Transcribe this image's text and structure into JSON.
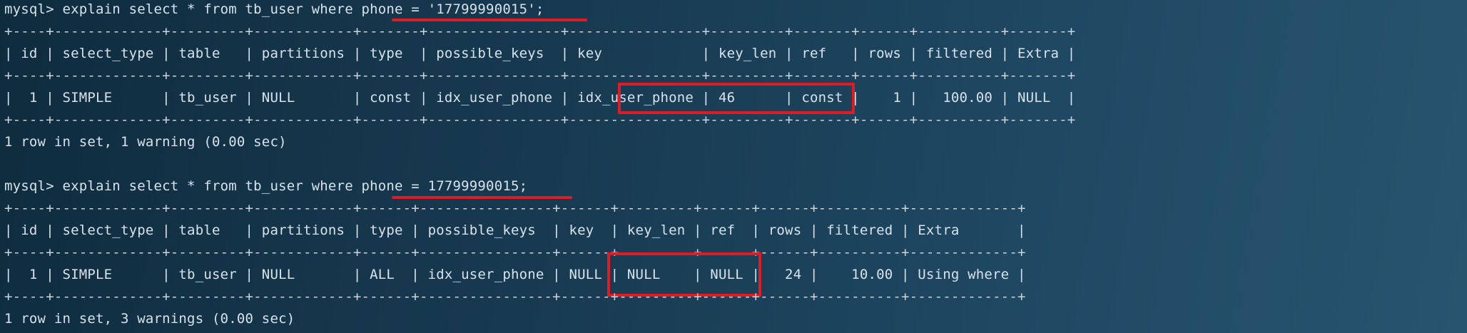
{
  "terminal": {
    "block1": {
      "command": "mysql> explain select * from tb_user where phone = '17799990015';",
      "separator": "+----+-------------+---------+------------+-------+----------------+----------------+---------+-------+------+----------+-------+",
      "header": "| id | select_type | table   | partitions | type  | possible_keys  | key            | key_len | ref   | rows | filtered | Extra |",
      "row": "|  1 | SIMPLE      | tb_user | NULL       | const | idx_user_phone | idx_user_phone | 46      | const |    1 |   100.00 | NULL  |",
      "result": "1 row in set, 1 warning (0.00 sec)"
    },
    "block2": {
      "command": "mysql> explain select * from tb_user where phone = 17799990015;",
      "separator": "+----+-------------+---------+------------+------+----------------+------+---------+------+------+----------+-------------+",
      "header": "| id | select_type | table   | partitions | type | possible_keys  | key  | key_len | ref  | rows | filtered | Extra       |",
      "row": "|  1 | SIMPLE      | tb_user | NULL       | ALL  | idx_user_phone | NULL | NULL    | NULL |   24 |    10.00 | Using where |",
      "result": "1 row in set, 3 warnings (0.00 sec)"
    }
  },
  "colors": {
    "highlight": "#e01b24",
    "text": "#d8e2ea",
    "background": "#17394f"
  }
}
